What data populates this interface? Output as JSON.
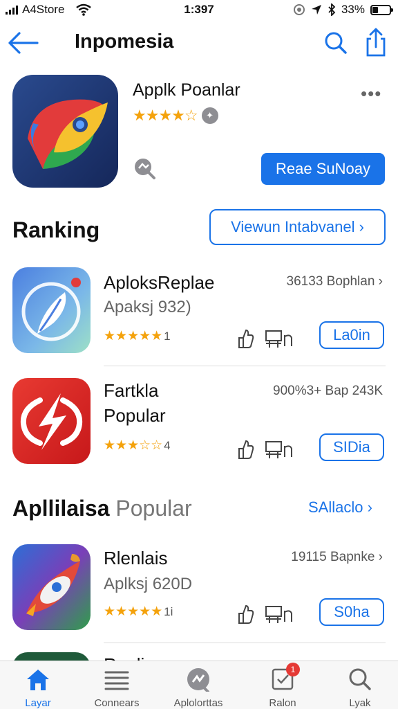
{
  "status_bar": {
    "carrier": "A4Store",
    "time": "1:397",
    "battery": "33%",
    "battery_fraction": 0.33
  },
  "header": {
    "title": "Inpomesia"
  },
  "featured": {
    "name": "Applk Poanlar",
    "rating": 3.5,
    "stars": "★★★★☆",
    "button_label": "Reae SuNoay",
    "more": "•••",
    "badge_glyph": "✦"
  },
  "ranking": {
    "title": "Ranking",
    "button_label": "Viewun Intabvanel ›",
    "items": [
      {
        "name": "AploksReplae",
        "subtitle": "Apaksj 932)",
        "meta": "36133 Bophlan ›",
        "stars": "★★★★★",
        "rating_text": "1",
        "button_label": "La0in"
      },
      {
        "name": "Fartkla\nPopular",
        "subtitle": "",
        "meta": "900%3+ Bap 243K",
        "stars": "★★★☆☆",
        "rating_text": "4",
        "button_label": "SIDia"
      }
    ]
  },
  "popular": {
    "title_strong": "Apllilaisa",
    "title_light": "Popular",
    "see_all": "SAllaclo ›",
    "items": [
      {
        "name": "Rlenlais",
        "subtitle": "Aplksj 620D",
        "meta": "19115 Bapnke ›",
        "stars": "★★★★★",
        "rating_text": "1i",
        "button_label": "S0ha"
      },
      {
        "name": "Raplias"
      }
    ]
  },
  "tab_bar": {
    "tabs": [
      {
        "label": "Layar",
        "icon": "home-icon",
        "active": true
      },
      {
        "label": "Connears",
        "icon": "list-icon",
        "active": false
      },
      {
        "label": "Aplolorttas",
        "icon": "apps-icon",
        "active": false
      },
      {
        "label": "Ralon",
        "icon": "updates-icon",
        "active": false,
        "badge": "1"
      },
      {
        "label": "Lyak",
        "icon": "search-icon",
        "active": false
      }
    ]
  },
  "colors": {
    "accent": "#1a73e8",
    "star": "#f4a20c",
    "badge": "#e53935"
  }
}
